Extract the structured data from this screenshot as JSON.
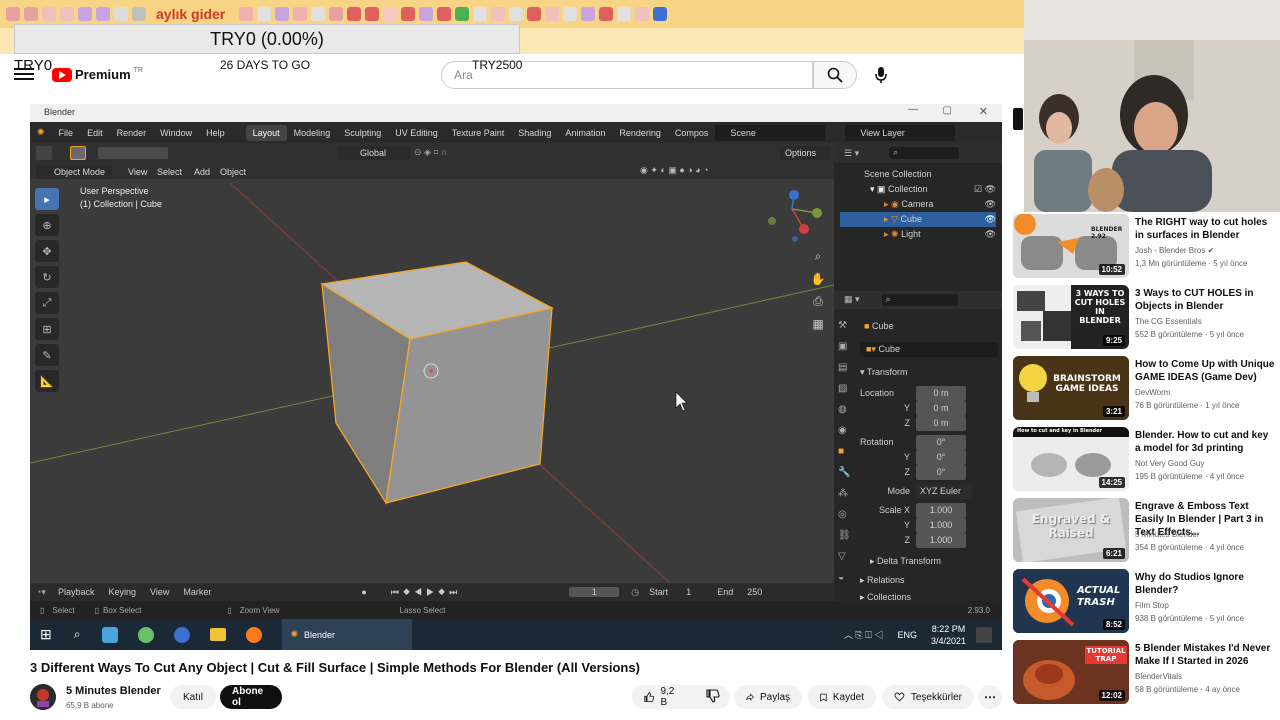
{
  "overlay": {
    "app_label": "aylık gider",
    "counter": "TRY0 (0.00%)",
    "corner": "TRY0",
    "days_to_go": "26 DAYS TO GO",
    "goal": "TRY2500"
  },
  "youtube": {
    "logo_text": "Premium",
    "region": "TR",
    "search_placeholder": "Ara"
  },
  "blender": {
    "window_title": "Blender",
    "menus": [
      "File",
      "Edit",
      "Render",
      "Window",
      "Help"
    ],
    "workspaces": [
      "Layout",
      "Modeling",
      "Sculpting",
      "UV Editing",
      "Texture Paint",
      "Shading",
      "Animation",
      "Rendering",
      "Compos"
    ],
    "scene": "Scene",
    "view_layer": "View Layer",
    "mode": "Object Mode",
    "view_menus": [
      "View",
      "Select",
      "Add",
      "Object"
    ],
    "orientation": "Global",
    "options": "Options",
    "perspective": "User Perspective",
    "collection_info": "(1) Collection | Cube",
    "outliner": {
      "root": "Scene Collection",
      "collection": "Collection",
      "items": [
        "Camera",
        "Cube",
        "Light"
      ]
    },
    "properties": {
      "object_name": "Cube",
      "data_name": "Cube",
      "section": "Transform",
      "location_label": "Location",
      "location": [
        "0 m",
        "0 m",
        "0 m"
      ],
      "rotation_label": "Rotation",
      "rotation": [
        "0°",
        "0°",
        "0°"
      ],
      "mode_label": "Mode",
      "mode_value": "XYZ Euler",
      "scale_label": "Scale X",
      "scale": [
        "1.000",
        "1.000",
        "1.000"
      ],
      "axis_y": "Y",
      "axis_z": "Z",
      "delta": "Delta Transform",
      "relations": "Relations",
      "collections": "Collections"
    },
    "timeline": {
      "playback": "Playback",
      "keying": "Keying",
      "view": "View",
      "marker": "Marker",
      "frame": "1",
      "start_label": "Start",
      "start": "1",
      "end_label": "End",
      "end": "250"
    },
    "status": {
      "select": "Select",
      "box_select": "Box Select",
      "zoom_view": "Zoom View",
      "lasso": "Lasso Select",
      "version": "2.93.0"
    },
    "taskbar": {
      "app": "Blender",
      "lang": "ENG",
      "time": "8:22 PM",
      "date": "3/4/2021"
    }
  },
  "video": {
    "title": "3 Different Ways To Cut Any Object | Cut & Fill Surface | Simple Methods For Blender (All Versions)",
    "channel": "5 Minutes Blender",
    "subscribers": "65,9 B abone",
    "join": "Katıl",
    "subscribe": "Abone ol",
    "likes": "9,2 B",
    "share": "Paylaş",
    "save": "Kaydet",
    "thanks": "Teşekkürler"
  },
  "sidebar": [
    {
      "title": "The RIGHT way to cut holes in surfaces in Blender",
      "channel": "Josh - Blender Bros",
      "meta": "1,3 Mn görüntüleme · 5 yıl önce",
      "duration": "10:52",
      "thumb_text": "BLENDER 2.92"
    },
    {
      "title": "3 Ways to CUT HOLES in Objects in Blender",
      "channel": "The CG Essentials",
      "meta": "552 B görüntüleme · 5 yıl önce",
      "duration": "9:25",
      "thumb_text": "3 WAYS TO CUT HOLES IN BLENDER"
    },
    {
      "title": "How to Come Up with Unique GAME IDEAS (Game Dev)",
      "channel": "DevWorm",
      "meta": "76 B görüntüleme · 1 yıl önce",
      "duration": "3:21",
      "thumb_text": "BRAINSTORM GAME IDEAS"
    },
    {
      "title": "Blender. How to cut and key a model for 3d printing",
      "channel": "Not Very Good Guy",
      "meta": "195 B görüntüleme · 4 yıl önce",
      "duration": "14:25",
      "thumb_text": "How to cut and key in Blender"
    },
    {
      "title": "Engrave & Emboss Text Easily In Blender | Part 3 in Text Effects...",
      "channel": "5 Minutes Blender",
      "meta": "354 B görüntüleme · 4 yıl önce",
      "duration": "6:21",
      "thumb_text": "Engraved & Raised"
    },
    {
      "title": "Why do Studios Ignore Blender?",
      "channel": "Film Stop",
      "meta": "938 B görüntüleme · 5 yıl önce",
      "duration": "8:52",
      "thumb_text": "ACTUAL TRASH"
    },
    {
      "title": "5 Blender Mistakes I'd Never Make If I Started in 2026",
      "channel": "BlenderVitals",
      "meta": "58 B görüntüleme · 4 ay önce",
      "duration": "12:02",
      "thumb_text": "TUTORIAL TRAP"
    }
  ],
  "colors": {
    "youtube_red": "#ff0000",
    "blender_orange": "#f5a623",
    "selection_blue": "#2d5e9e"
  }
}
